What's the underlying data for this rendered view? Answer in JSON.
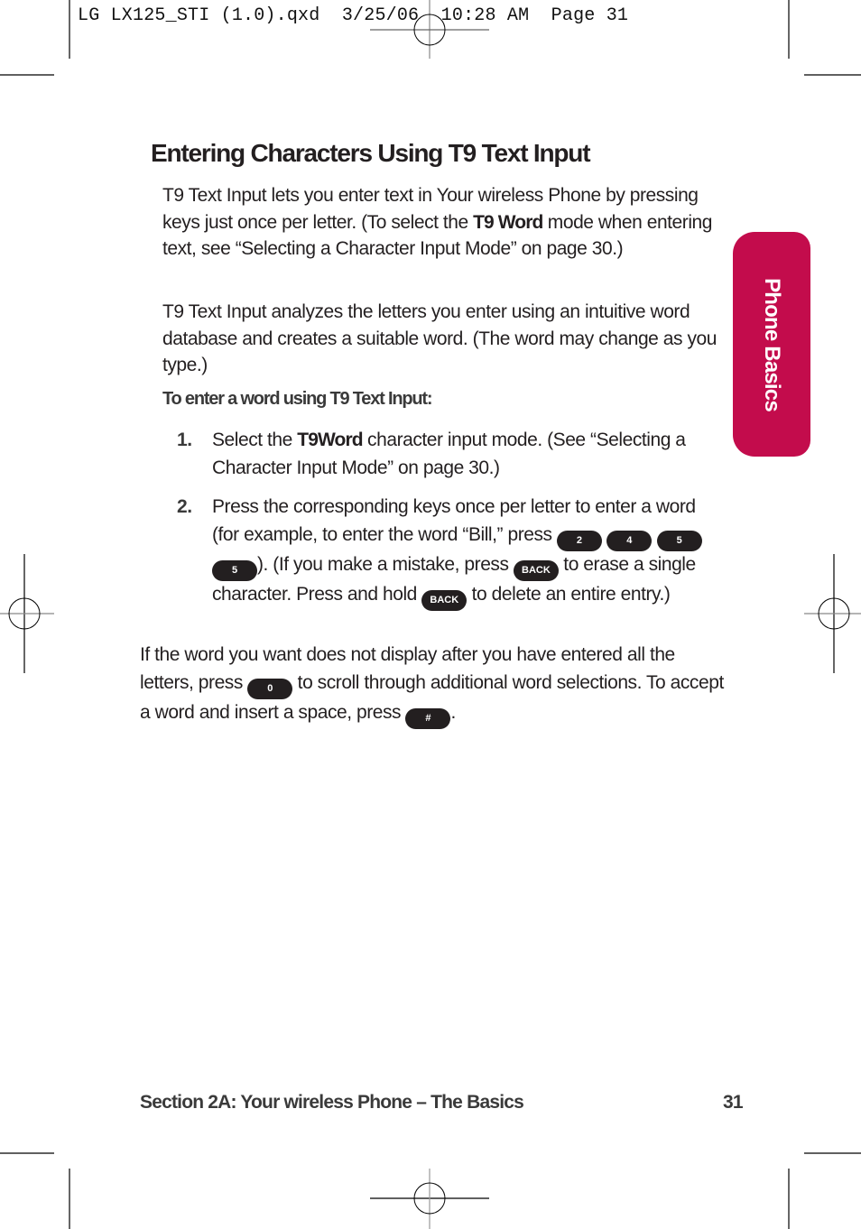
{
  "slug_line": "LG LX125_STI (1.0).qxd  3/25/06  10:28 AM  Page 31",
  "title": "Entering Characters Using T9 Text Input",
  "intro": {
    "part1": "T9 Text Input lets you enter text in Your wireless Phone by pressing keys just once per letter. (To select the ",
    "bold": "T9 Word",
    "part2": " mode when entering text, see “Selecting a Character Input Mode” on page 30.)"
  },
  "paragraph2": "T9 Text Input analyzes the letters you enter using an intuitive word database and creates a suitable word. (The word may change as you type.)",
  "subheading": "To enter a word using T9 Text Input:",
  "steps": [
    {
      "number": "1.",
      "part1": "Select the ",
      "bold": "T9Word",
      "part2": " character input mode. (See “Selecting a Character Input Mode” on page 30.)"
    },
    {
      "number": "2.",
      "part1": "Press the corresponding keys once per letter to enter a word (for example, to enter the word “Bill,” press ",
      "keys": [
        "2",
        "4",
        "5",
        "5"
      ],
      "part2": "). (If you make a mistake, press ",
      "key_back": "BACK",
      "part3": " to erase a single character. Press and hold ",
      "part4": " to delete an entire entry.)"
    }
  ],
  "closing": {
    "part1": "If the word you want does not display after you have entered all the letters, press ",
    "key_zero": "0",
    "part2": " to scroll through additional word selections. To accept a word and insert a space, press ",
    "key_hash": "#",
    "part3": "."
  },
  "side_tab": {
    "label": "Phone Basics",
    "color": "#c30c4c"
  },
  "footer": {
    "section": "Section 2A: Your wireless Phone – The Basics",
    "page_number": "31"
  }
}
